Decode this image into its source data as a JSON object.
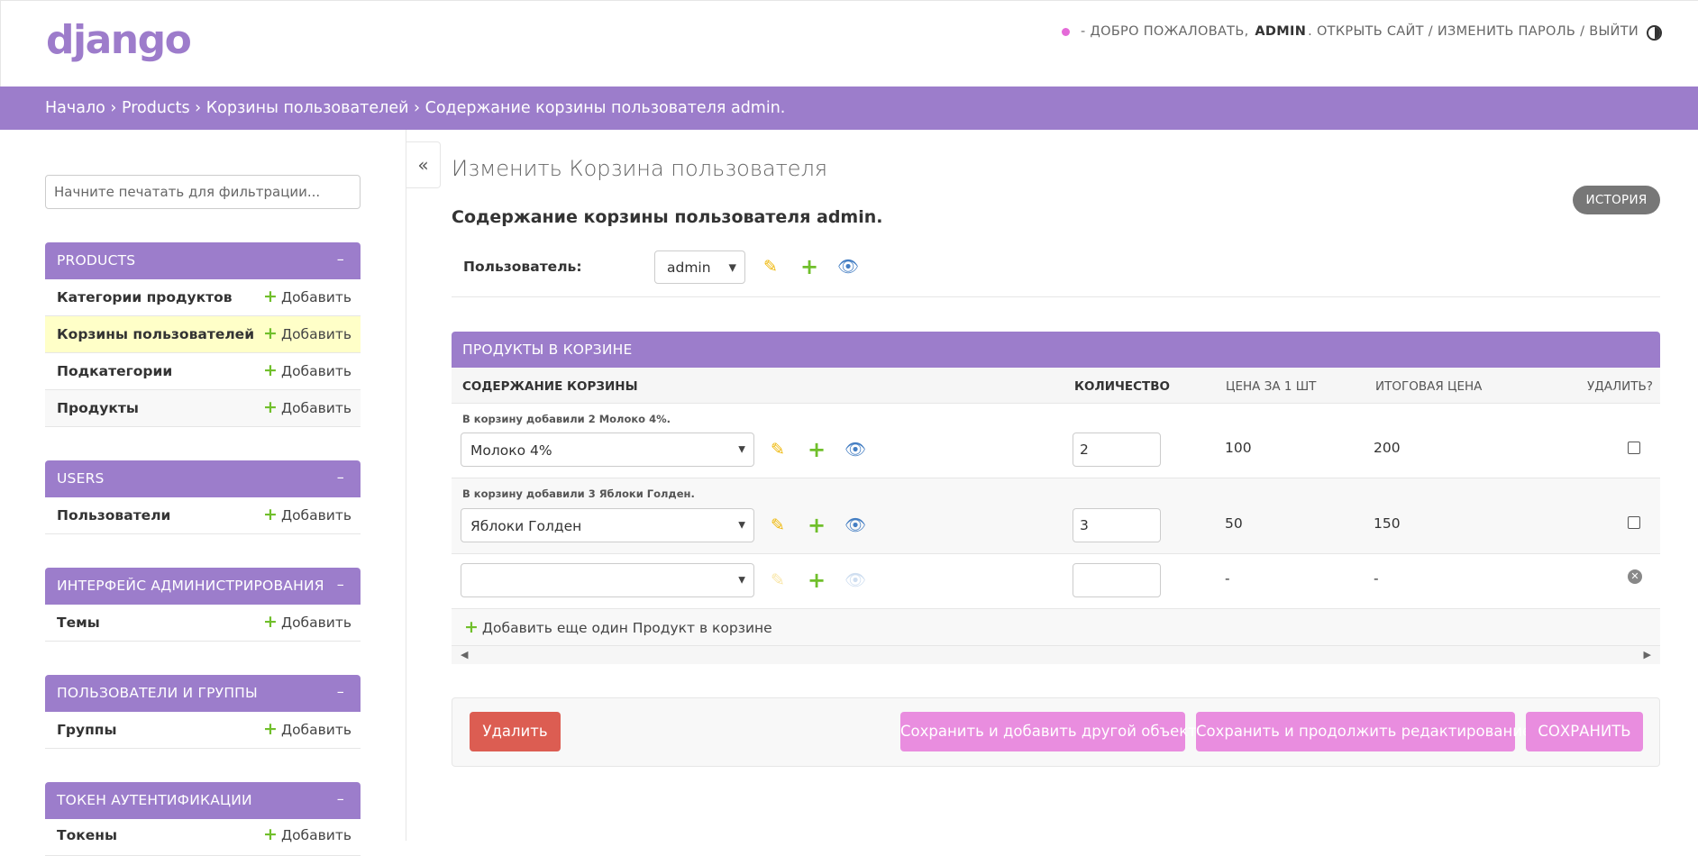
{
  "header": {
    "brand": "django",
    "welcome": "- ДОБРО ПОЖАЛОВАТЬ,",
    "username": "ADMIN",
    "view_site": "ОТКРЫТЬ САЙТ",
    "change_password": "ИЗМЕНИТЬ ПАРОЛЬ",
    "logout": "ВЫЙТИ",
    "separator": "/"
  },
  "breadcrumbs": {
    "home": "Начало",
    "app": "Products",
    "model": "Корзины пользователей",
    "current": "Содержание корзины пользователя admin.",
    "sep": "›"
  },
  "sidebar": {
    "filter_placeholder": "Начните печатать для фильтрации...",
    "add_label": "Добавить",
    "collapse_symbol": "–",
    "modules": [
      {
        "caption": "PRODUCTS",
        "models": [
          "Категории продуктов",
          "Корзины пользователей",
          "Подкатегории",
          "Продукты"
        ]
      },
      {
        "caption": "USERS",
        "models": [
          "Пользователи"
        ]
      },
      {
        "caption": "ИНТЕРФЕЙС АДМИНИСТРИРОВАНИЯ",
        "models": [
          "Темы"
        ]
      },
      {
        "caption": "ПОЛЬЗОВАТЕЛИ И ГРУППЫ",
        "models": [
          "Группы"
        ]
      },
      {
        "caption": "ТОКЕН АУТЕНТИФИКАЦИИ",
        "models": [
          "Токены"
        ]
      }
    ]
  },
  "nav_toggle": "«",
  "content": {
    "title": "Изменить Корзина пользователя",
    "history_label": "ИСТОРИЯ",
    "object_title": "Содержание корзины пользователя admin.",
    "user_field": {
      "label": "Пользователь:",
      "value": "admin"
    }
  },
  "inline": {
    "caption": "ПРОДУКТЫ В КОРЗИНЕ",
    "columns": [
      "СОДЕРЖАНИЕ КОРЗИНЫ",
      "КОЛИЧЕСТВО",
      "ЦЕНА ЗА 1 ШТ",
      "ИТОГОВАЯ ЦЕНА",
      "УДАЛИТЬ?"
    ],
    "rows": [
      {
        "note": "В корзину добавили 2 Молоко 4%.",
        "product": "Молоко 4%",
        "quantity": "2",
        "price": "100",
        "total": "200"
      },
      {
        "note": "В корзину добавили 3 Яблоки Голден.",
        "product": "Яблоки Голден",
        "quantity": "3",
        "price": "50",
        "total": "150"
      },
      {
        "note": "",
        "product": "",
        "quantity": "",
        "price": "-",
        "total": "-"
      }
    ],
    "add_another": "Добавить еще один Продукт в корзине"
  },
  "submit": {
    "delete": "Удалить",
    "save_add": "Сохранить и добавить другой объект",
    "save_continue": "Сохранить и продолжить редактирование",
    "save": "СОХРАНИТЬ"
  },
  "colors": {
    "accent": "#9c7dcb",
    "delete": "#dc5d52",
    "save_buttons": "#e98ddf",
    "current_row": "#ffffc8"
  }
}
